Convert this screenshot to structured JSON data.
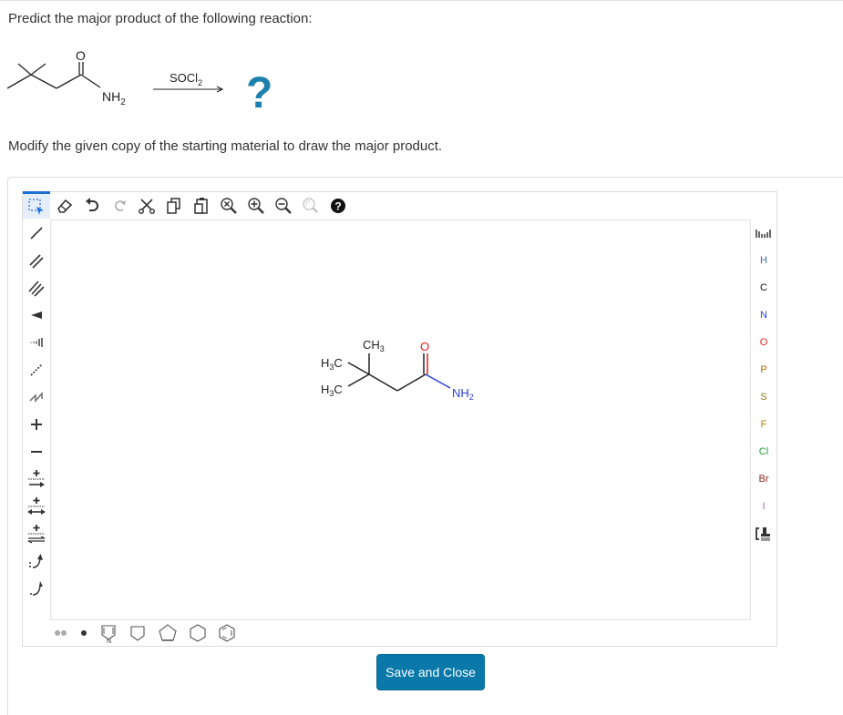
{
  "question": {
    "prompt": "Predict the major product of the following reaction:",
    "reagent": "SOCl",
    "reagent_subscript": "2",
    "unknown_product": "?",
    "starting_material_label": "NH",
    "starting_material_subscript": "2",
    "oxygen_label": "O",
    "instruction": "Modify the given copy of the starting material to draw the major product."
  },
  "editor": {
    "top_toolbar": [
      {
        "name": "select-tool",
        "label": "Select"
      },
      {
        "name": "erase-tool",
        "label": "Erase"
      },
      {
        "name": "undo",
        "label": "Undo"
      },
      {
        "name": "redo",
        "label": "Redo"
      },
      {
        "name": "cut",
        "label": "Cut"
      },
      {
        "name": "copy",
        "label": "Copy"
      },
      {
        "name": "paste",
        "label": "Paste"
      },
      {
        "name": "zoom-fit",
        "label": "Zoom to fit"
      },
      {
        "name": "zoom-in",
        "label": "Zoom in"
      },
      {
        "name": "zoom-out",
        "label": "Zoom out"
      },
      {
        "name": "zoom-reset",
        "label": "Reset zoom"
      },
      {
        "name": "help",
        "label": "Help"
      }
    ],
    "left_toolbar": [
      "single-bond",
      "double-bond",
      "triple-bond",
      "wedge-bond",
      "hash-bond",
      "dashed-bond",
      "chain",
      "positive-charge",
      "negative-charge",
      "forward-reaction-arrow",
      "resonance-arrow",
      "equilibrium-arrow",
      "electron-pair-arrow",
      "single-electron-arrow"
    ],
    "right_toolbar": {
      "periodic_table": "Periodic table",
      "elements": [
        {
          "symbol": "H",
          "color": "#3b6fb0"
        },
        {
          "symbol": "C",
          "color": "#111111"
        },
        {
          "symbol": "N",
          "color": "#2b3dd1"
        },
        {
          "symbol": "O",
          "color": "#e0201b"
        },
        {
          "symbol": "P",
          "color": "#b86d00"
        },
        {
          "symbol": "S",
          "color": "#8a7a1a"
        },
        {
          "symbol": "F",
          "color": "#b07a10"
        },
        {
          "symbol": "Cl",
          "color": "#1f9a3a"
        },
        {
          "symbol": "Br",
          "color": "#8a2a1a"
        },
        {
          "symbol": "I",
          "color": "#a060c0"
        }
      ],
      "bracket": "Bracket"
    },
    "bottom_toolbar": [
      "radical-pair",
      "radical",
      "pyrrole",
      "cyclobutane",
      "cyclopentane",
      "cyclohexane",
      "benzene"
    ],
    "molecule": {
      "ch3_top": "CH",
      "ch3_top_sub": "3",
      "h3c_upper": "H",
      "h3c_upper_sub": "3",
      "h3c_upper_c": "C",
      "h3c_lower": "H",
      "h3c_lower_sub": "3",
      "h3c_lower_c": "C",
      "oxygen": "O",
      "amine": "NH",
      "amine_sub": "2"
    }
  },
  "actions": {
    "save_close_label": "Save and Close",
    "accent_color": "#0a79a9"
  }
}
